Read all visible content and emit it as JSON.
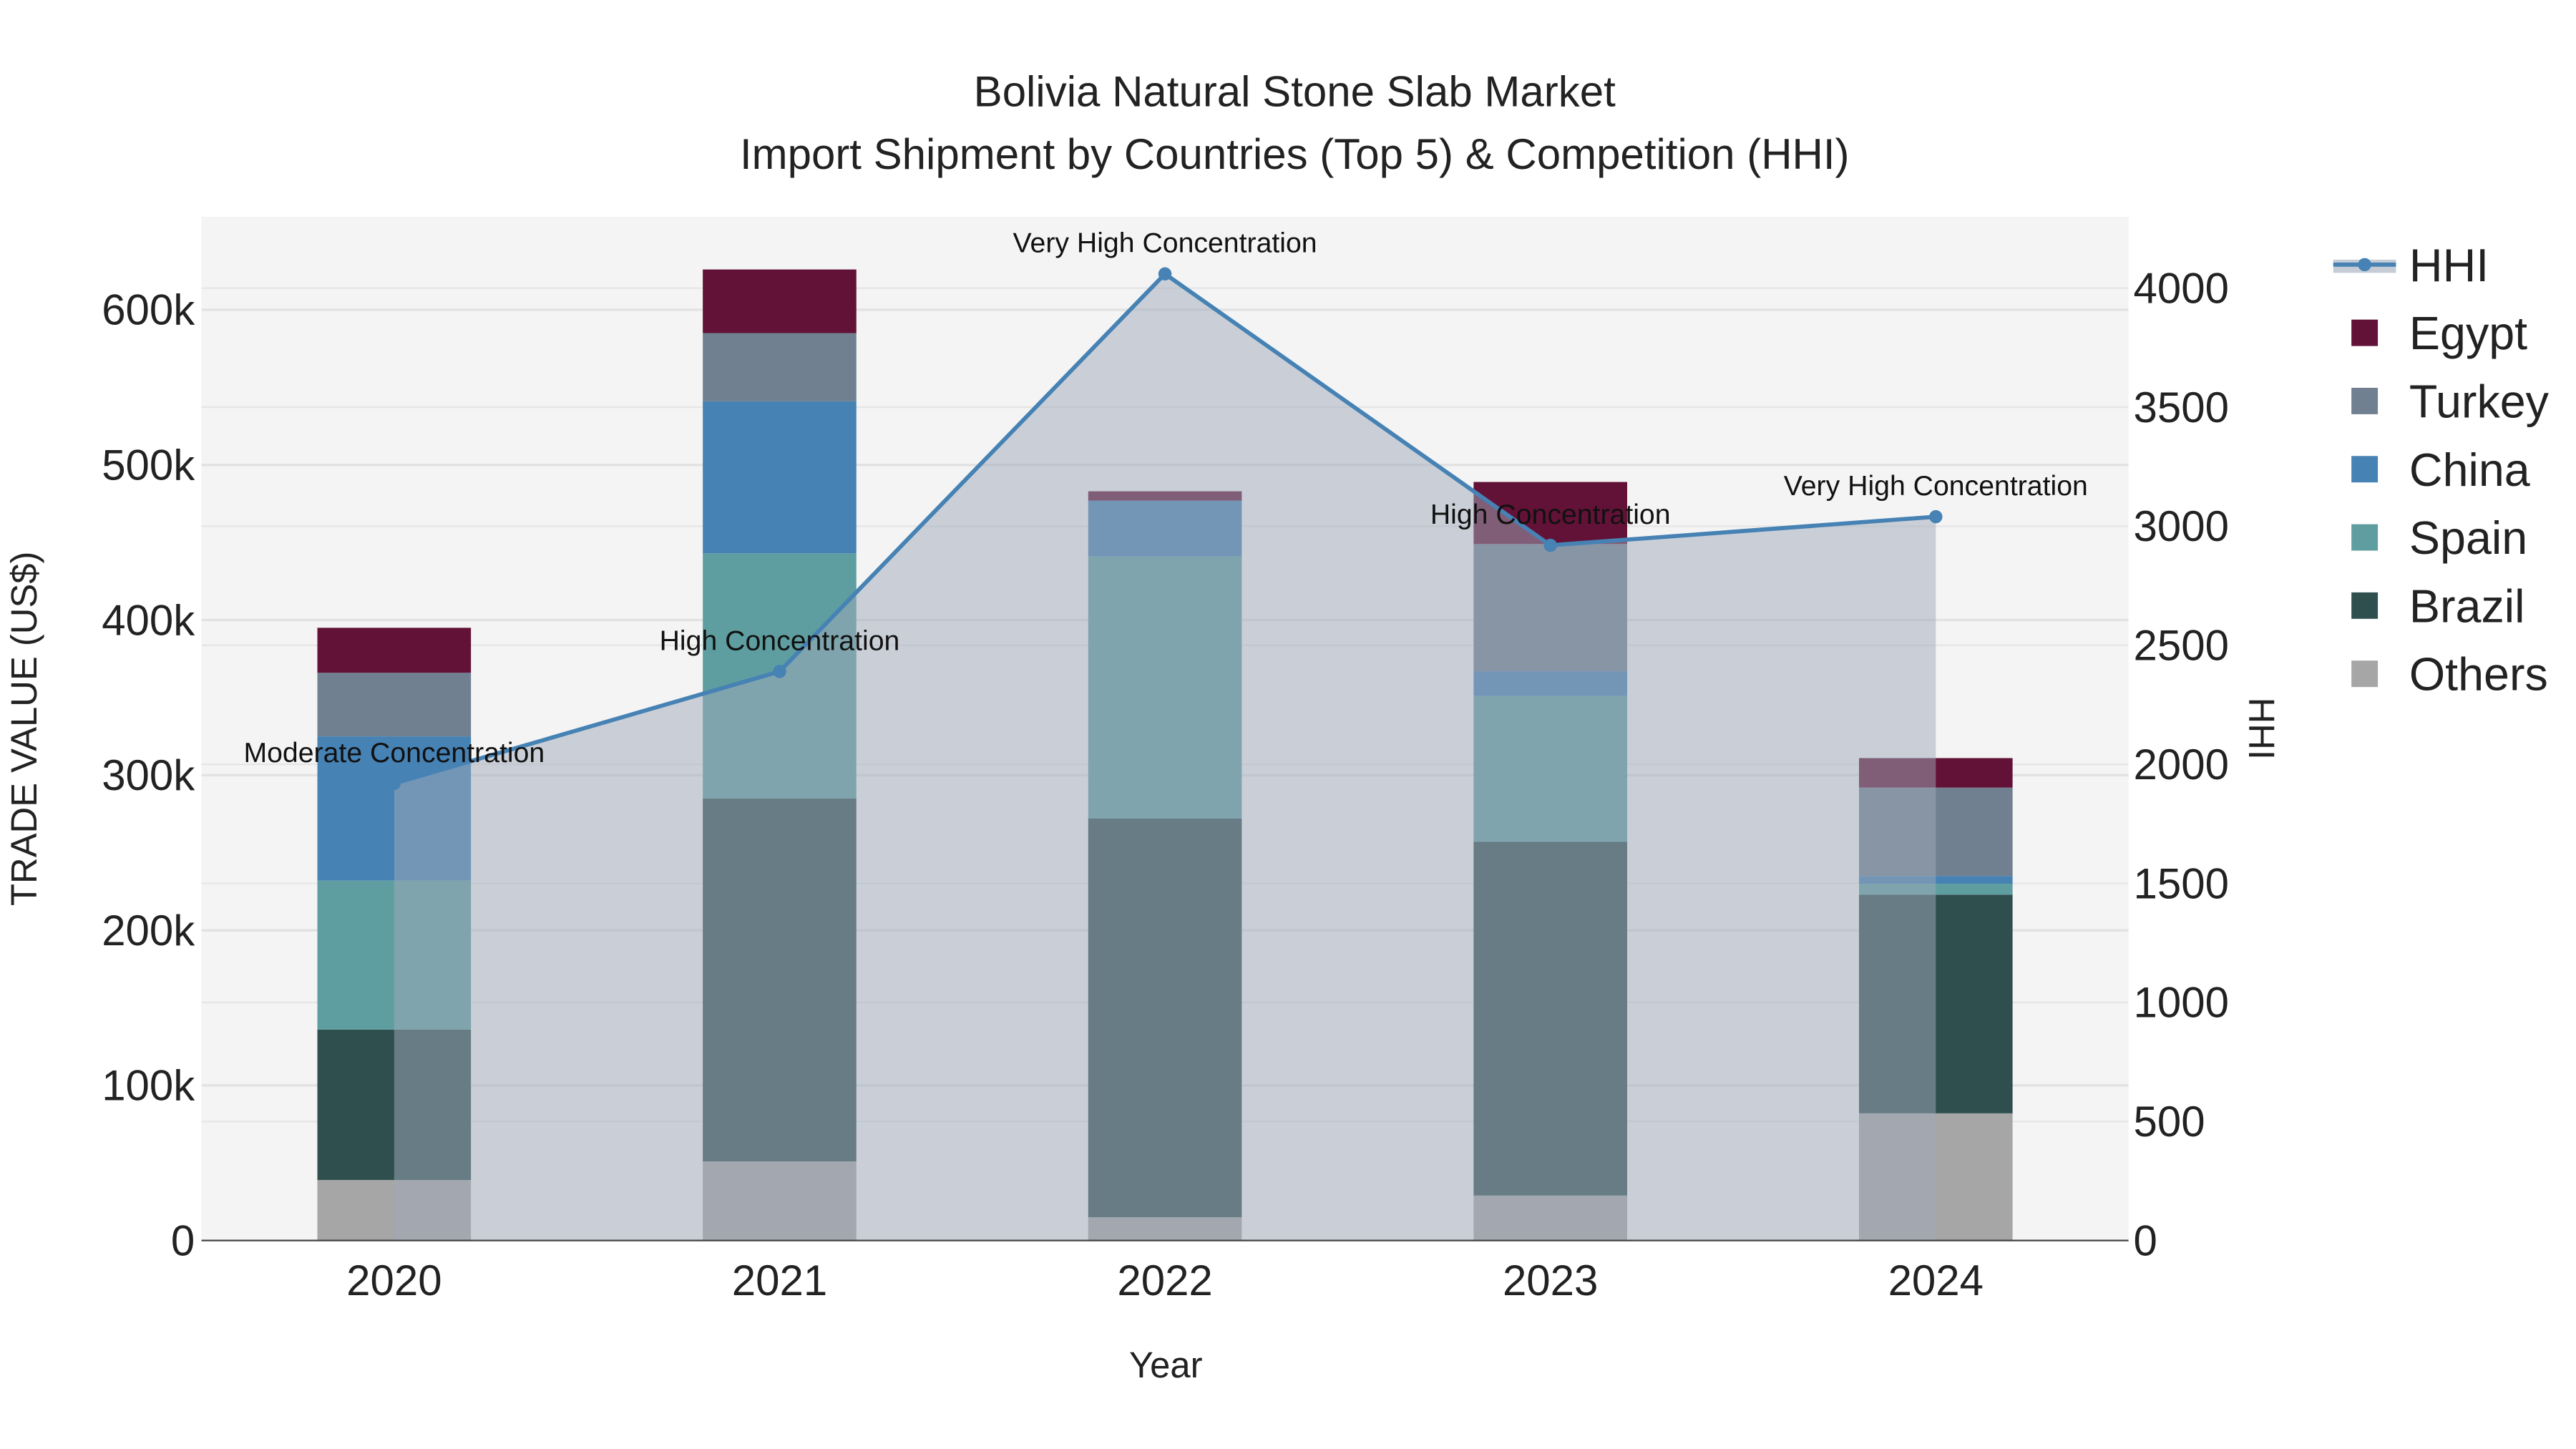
{
  "chart_data": {
    "type": "bar",
    "stacked": true,
    "title": "Bolivia Natural Stone Slab Market",
    "subtitle": "Import Shipment by Countries (Top 5) & Competition (HHI)",
    "xlabel": "Year",
    "ylabel": "TRADE VALUE (US$)",
    "y2label": "HHI",
    "categories": [
      "2020",
      "2021",
      "2022",
      "2023",
      "2024"
    ],
    "ylim": [
      0,
      660000
    ],
    "y_ticks": [
      0,
      100000,
      200000,
      300000,
      400000,
      500000,
      600000
    ],
    "y_tick_labels": [
      "0",
      "100k",
      "200k",
      "300k",
      "400k",
      "500k",
      "600k"
    ],
    "y2lim": [
      0,
      4300
    ],
    "y2_ticks": [
      0,
      500,
      1000,
      1500,
      2000,
      2500,
      3000,
      3500,
      4000
    ],
    "y2_tick_labels": [
      "0",
      "500",
      "1000",
      "1500",
      "2000",
      "2500",
      "3000",
      "3500",
      "4000"
    ],
    "series": [
      {
        "name": "Others",
        "color": "#a6a6a6",
        "values": [
          39000,
          51000,
          15000,
          29000,
          82000
        ]
      },
      {
        "name": "Brazil",
        "color": "#2f4f4f",
        "values": [
          97000,
          234000,
          257000,
          228000,
          141000
        ]
      },
      {
        "name": "Spain",
        "color": "#5f9ea0",
        "values": [
          96000,
          158000,
          169000,
          94000,
          7000
        ]
      },
      {
        "name": "China",
        "color": "#4682b4",
        "values": [
          93000,
          98000,
          36000,
          16000,
          5000
        ]
      },
      {
        "name": "Turkey",
        "color": "#708090",
        "values": [
          41000,
          44000,
          0,
          82000,
          57000
        ]
      },
      {
        "name": "Egypt",
        "color": "#621236",
        "values": [
          29000,
          41000,
          6000,
          40000,
          19000
        ]
      }
    ],
    "hhi": {
      "name": "HHI",
      "color": "#4682b4",
      "values": [
        1920,
        2390,
        4060,
        2920,
        3040
      ],
      "annotations": [
        "Moderate Concentration",
        "High Concentration",
        "Very High Concentration",
        "High Concentration",
        "Very High Concentration"
      ]
    },
    "legend_order": [
      "HHI",
      "Egypt",
      "Turkey",
      "China",
      "Spain",
      "Brazil",
      "Others"
    ],
    "legend_position": "right",
    "grid": true
  }
}
